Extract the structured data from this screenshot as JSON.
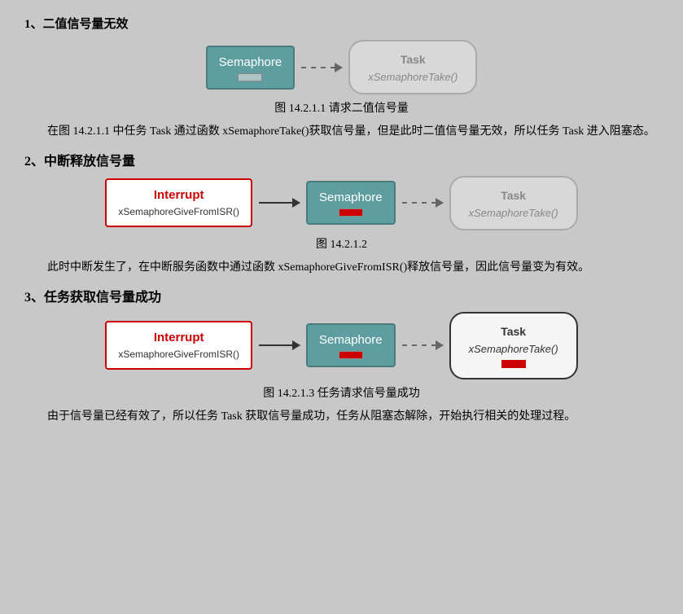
{
  "sections": {
    "section1": {
      "title": "1、二值信号量无效",
      "diagram": {
        "semaphore_label": "Semaphore",
        "task_title": "Task",
        "task_func": "xSemaphoreTake()"
      },
      "caption": "图 14.2.1.1  请求二值信号量",
      "body": "在图 14.2.1.1 中任务 Task 通过函数 xSemaphoreTake()获取信号量，但是此时二值信号量无效，所以任务 Task 进入阻塞态。"
    },
    "section2": {
      "title": "2、中断释放信号量",
      "diagram": {
        "interrupt_title": "Interrupt",
        "interrupt_func": "xSemaphoreGiveFromISR()",
        "semaphore_label": "Semaphore",
        "task_title": "Task",
        "task_func": "xSemaphoreTake()"
      },
      "caption": "图 14.2.1.2",
      "body": "此时中断发生了，在中断服务函数中通过函数 xSemaphoreGiveFromISR()释放信号量，因此信号量变为有效。"
    },
    "section3": {
      "title": "3、任务获取信号量成功",
      "diagram": {
        "interrupt_title": "Interrupt",
        "interrupt_func": "xSemaphoreGiveFromISR()",
        "semaphore_label": "Semaphore",
        "task_title": "Task",
        "task_func": "xSemaphoreTake()"
      },
      "caption": "图 14.2.1.3  任务请求信号量成功",
      "body": "由于信号量已经有效了，所以任务 Task 获取信号量成功，任务从阻塞态解除，开始执行相关的处理过程。"
    }
  }
}
